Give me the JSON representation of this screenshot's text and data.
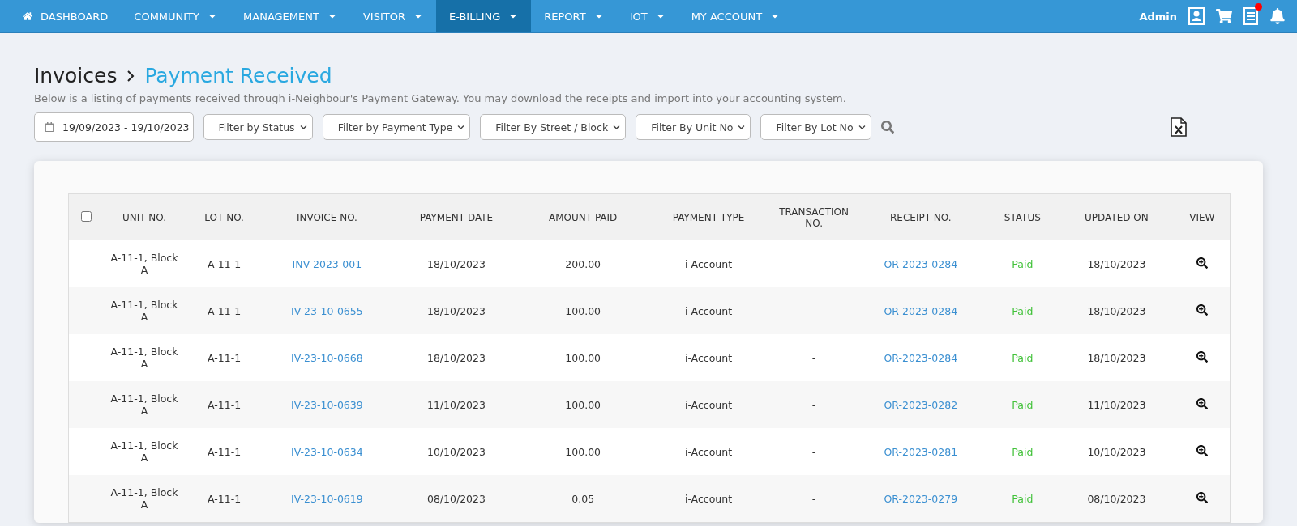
{
  "nav": {
    "items": [
      {
        "label": "DASHBOARD",
        "dropdown": false,
        "home": true,
        "selected": false
      },
      {
        "label": "COMMUNITY",
        "dropdown": true,
        "home": false,
        "selected": false
      },
      {
        "label": "MANAGEMENT",
        "dropdown": true,
        "home": false,
        "selected": false
      },
      {
        "label": "VISITOR",
        "dropdown": true,
        "home": false,
        "selected": false
      },
      {
        "label": "E-BILLING",
        "dropdown": true,
        "home": false,
        "selected": true
      },
      {
        "label": "REPORT",
        "dropdown": true,
        "home": false,
        "selected": false
      },
      {
        "label": "IOT",
        "dropdown": true,
        "home": false,
        "selected": false
      },
      {
        "label": "MY ACCOUNT",
        "dropdown": true,
        "home": false,
        "selected": false
      }
    ],
    "user": "Admin",
    "notification": true
  },
  "breadcrumb": [
    "Invoices",
    "Payment Received"
  ],
  "description": "Below is a listing of payments received through i-Neighbour's Payment Gateway. You may download the receipts and import into your accounting system.",
  "filters": {
    "date_range": "19/09/2023 - 19/10/2023",
    "selects": [
      "Filter by Status",
      "Filter by Payment Type",
      "Filter By Street / Block",
      "Filter By Unit No",
      "Filter By Lot No"
    ]
  },
  "table": {
    "select_all_checked": false,
    "columns": [
      "UNIT NO.",
      "LOT NO.",
      "INVOICE NO.",
      "PAYMENT DATE",
      "AMOUNT PAID",
      "PAYMENT TYPE",
      "TRANSACTION NO.",
      "RECEIPT NO.",
      "STATUS",
      "UPDATED ON",
      "VIEW"
    ],
    "rows": [
      {
        "unit": "A-11-1, Block A",
        "lot": "A-11-1",
        "invoice": "INV-2023-001",
        "date": "18/10/2023",
        "amount": "200.00",
        "type": "i-Account",
        "transaction": "-",
        "receipt": "OR-2023-0284",
        "status": "Paid",
        "updated": "18/10/2023"
      },
      {
        "unit": "A-11-1, Block A",
        "lot": "A-11-1",
        "invoice": "IV-23-10-0655",
        "date": "18/10/2023",
        "amount": "100.00",
        "type": "i-Account",
        "transaction": "-",
        "receipt": "OR-2023-0284",
        "status": "Paid",
        "updated": "18/10/2023"
      },
      {
        "unit": "A-11-1, Block A",
        "lot": "A-11-1",
        "invoice": "IV-23-10-0668",
        "date": "18/10/2023",
        "amount": "100.00",
        "type": "i-Account",
        "transaction": "-",
        "receipt": "OR-2023-0284",
        "status": "Paid",
        "updated": "18/10/2023"
      },
      {
        "unit": "A-11-1, Block A",
        "lot": "A-11-1",
        "invoice": "IV-23-10-0639",
        "date": "11/10/2023",
        "amount": "100.00",
        "type": "i-Account",
        "transaction": "-",
        "receipt": "OR-2023-0282",
        "status": "Paid",
        "updated": "11/10/2023"
      },
      {
        "unit": "A-11-1, Block A",
        "lot": "A-11-1",
        "invoice": "IV-23-10-0634",
        "date": "10/10/2023",
        "amount": "100.00",
        "type": "i-Account",
        "transaction": "-",
        "receipt": "OR-2023-0281",
        "status": "Paid",
        "updated": "10/10/2023"
      },
      {
        "unit": "A-11-1, Block A",
        "lot": "A-11-1",
        "invoice": "IV-23-10-0619",
        "date": "08/10/2023",
        "amount": "0.05",
        "type": "i-Account",
        "transaction": "-",
        "receipt": "OR-2023-0279",
        "status": "Paid",
        "updated": "08/10/2023"
      }
    ]
  }
}
